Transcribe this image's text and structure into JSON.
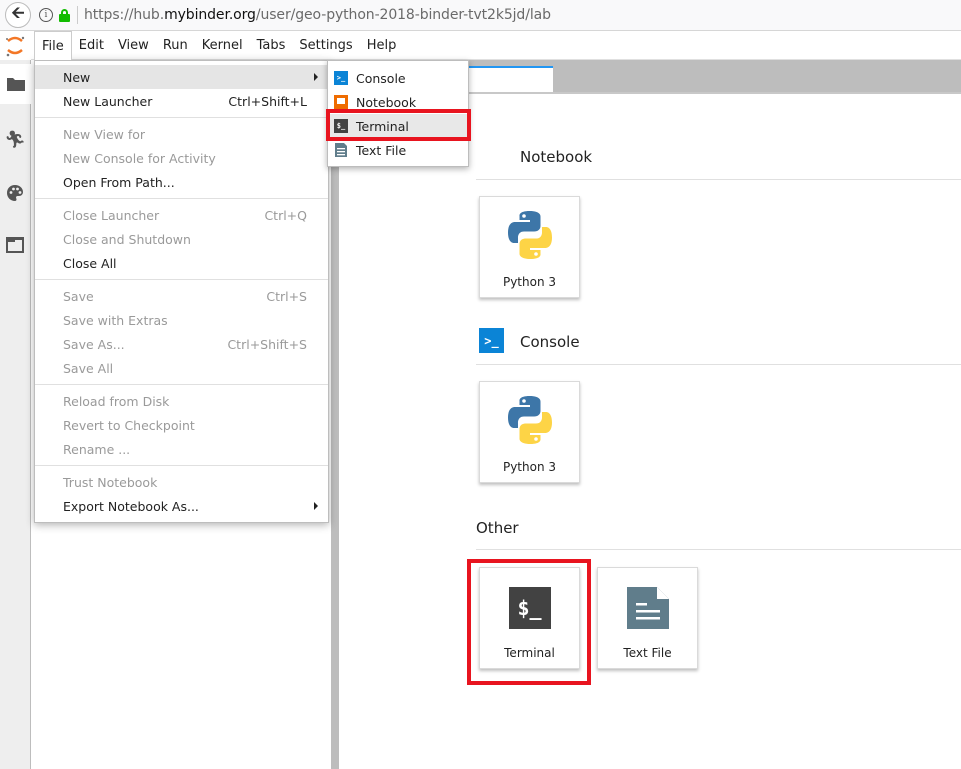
{
  "browser": {
    "url_prefix": "https://hub.",
    "url_host": "mybinder.org",
    "url_path": "/user/geo-python-2018-binder-tvt2k5jd/lab"
  },
  "menubar": {
    "items": [
      "File",
      "Edit",
      "View",
      "Run",
      "Kernel",
      "Tabs",
      "Settings",
      "Help"
    ]
  },
  "file_menu": {
    "groups": [
      [
        {
          "label": "New",
          "shortcut": "",
          "submenu": true,
          "disabled": false,
          "hover": true
        },
        {
          "label": "New Launcher",
          "shortcut": "Ctrl+Shift+L",
          "disabled": false
        }
      ],
      [
        {
          "label": "New View for",
          "shortcut": "",
          "disabled": true
        },
        {
          "label": "New Console for Activity",
          "shortcut": "",
          "disabled": true
        },
        {
          "label": "Open From Path...",
          "shortcut": "",
          "disabled": false
        }
      ],
      [
        {
          "label": "Close Launcher",
          "shortcut": "Ctrl+Q",
          "disabled": true
        },
        {
          "label": "Close and Shutdown",
          "shortcut": "",
          "disabled": true
        },
        {
          "label": "Close All",
          "shortcut": "",
          "disabled": false
        }
      ],
      [
        {
          "label": "Save",
          "shortcut": "Ctrl+S",
          "disabled": true
        },
        {
          "label": "Save with Extras",
          "shortcut": "",
          "disabled": true
        },
        {
          "label": "Save As...",
          "shortcut": "Ctrl+Shift+S",
          "disabled": true
        },
        {
          "label": "Save All",
          "shortcut": "",
          "disabled": true
        }
      ],
      [
        {
          "label": "Reload from Disk",
          "shortcut": "",
          "disabled": true
        },
        {
          "label": "Revert to Checkpoint",
          "shortcut": "",
          "disabled": true
        },
        {
          "label": "Rename ...",
          "shortcut": "",
          "disabled": true
        }
      ],
      [
        {
          "label": "Trust Notebook",
          "shortcut": "",
          "disabled": true
        },
        {
          "label": "Export Notebook As...",
          "shortcut": "",
          "submenu": true,
          "disabled": false
        }
      ]
    ]
  },
  "new_submenu": {
    "items": [
      {
        "label": "Console",
        "icon": "console-icon"
      },
      {
        "label": "Notebook",
        "icon": "notebook-icon"
      },
      {
        "label": "Terminal",
        "icon": "terminal-icon",
        "highlighted": true
      },
      {
        "label": "Text File",
        "icon": "text-file-icon"
      }
    ]
  },
  "launcher": {
    "sections": {
      "notebook": {
        "title": "Notebook",
        "cards": [
          {
            "label": "Python 3"
          }
        ]
      },
      "console": {
        "title": "Console",
        "cards": [
          {
            "label": "Python 3"
          }
        ]
      },
      "other": {
        "title": "Other",
        "cards": [
          {
            "label": "Terminal",
            "highlighted": true
          },
          {
            "label": "Text File"
          }
        ]
      }
    }
  },
  "colors": {
    "highlight_box": "#e8141f",
    "active_tab_accent": "#2196f3",
    "console_icon": "#0b84d6",
    "terminal_icon": "#424242",
    "text_file_icon": "#607d8b",
    "notebook_icon": "#ef6c00"
  }
}
